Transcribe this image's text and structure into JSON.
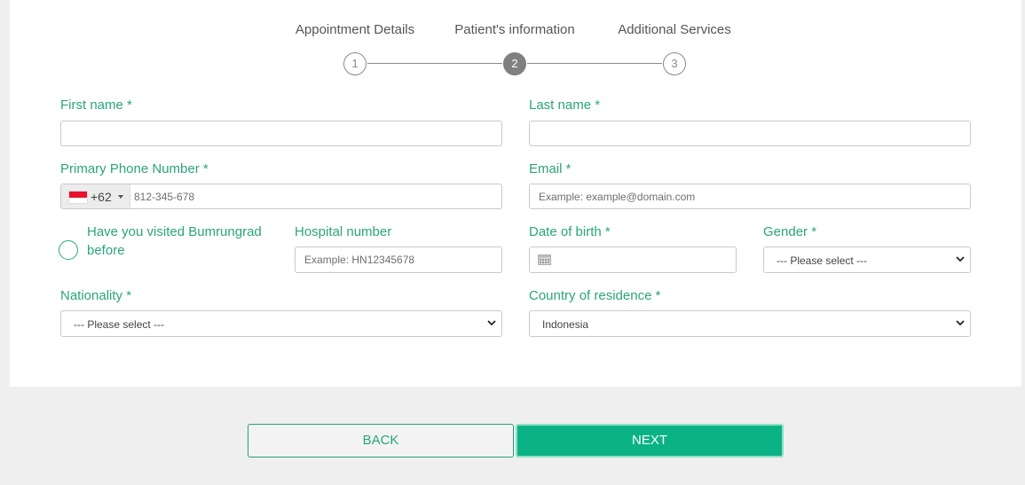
{
  "stepper": {
    "steps": [
      {
        "label": "Appointment Details",
        "number": "1",
        "active": false
      },
      {
        "label": "Patient's information",
        "number": "2",
        "active": true
      },
      {
        "label": "Additional Services",
        "number": "3",
        "active": false
      }
    ]
  },
  "form": {
    "first_name": {
      "label": "First name *",
      "value": ""
    },
    "last_name": {
      "label": "Last name *",
      "value": ""
    },
    "phone": {
      "label": "Primary Phone Number *",
      "country_code": "+62",
      "placeholder": "812-345-678"
    },
    "email": {
      "label": "Email *",
      "placeholder": "Example: example@domain.com"
    },
    "visited": {
      "label": "Have you visited Bumrungrad before",
      "checked": false
    },
    "hospital_number": {
      "label": "Hospital number",
      "placeholder": "Example: HN12345678"
    },
    "date_of_birth": {
      "label": "Date of birth *",
      "value": ""
    },
    "gender": {
      "label": "Gender *",
      "selected": "--- Please select ---"
    },
    "nationality": {
      "label": "Nationality *",
      "selected": "--- Please select ---"
    },
    "country_of_residence": {
      "label": "Country of residence *",
      "selected": "Indonesia"
    }
  },
  "buttons": {
    "back": "BACK",
    "next": "NEXT"
  },
  "colors": {
    "accent": "#2aa57a",
    "primary_button": "#0bb286",
    "step_active": "#808080"
  },
  "icons": {
    "flag": "indonesia-flag-icon",
    "calendar": "calendar-icon",
    "dropdown": "chevron-down-icon"
  }
}
